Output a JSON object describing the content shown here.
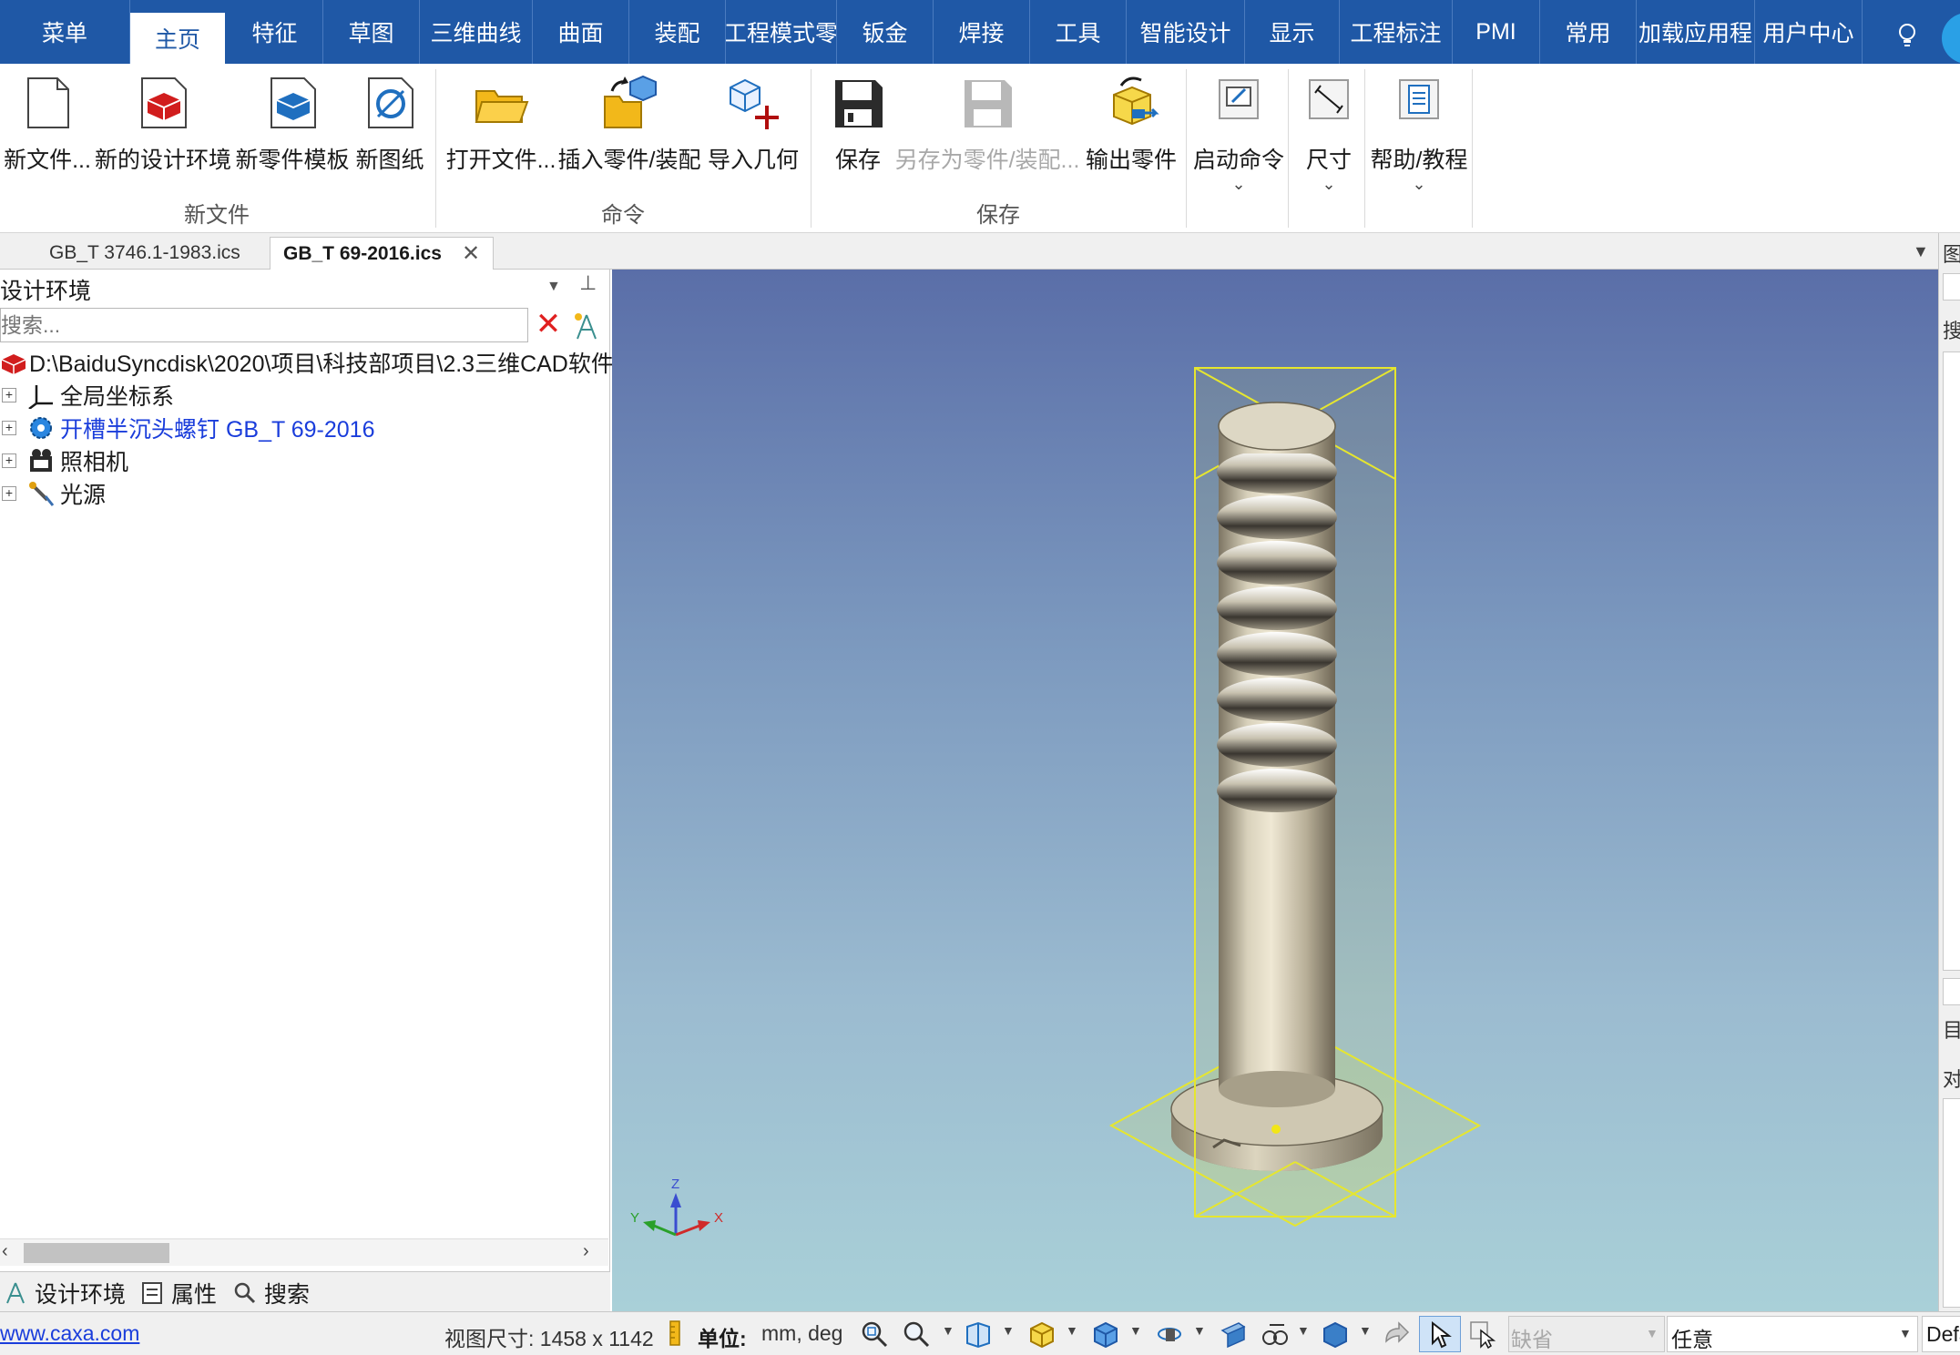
{
  "menubar": {
    "tabs": [
      "菜单",
      "主页",
      "特征",
      "草图",
      "三维曲线",
      "曲面",
      "装配",
      "工程模式零",
      "钣金",
      "焊接",
      "工具",
      "智能设计",
      "显示",
      "工程标注",
      "PMI",
      "常用",
      "加载应用程",
      "用户中心"
    ],
    "active_tab": "主页"
  },
  "ribbon": {
    "buttons": {
      "new_file": "新文件...",
      "new_design_env": "新的设计环境",
      "new_part_template": "新零件模板",
      "new_drawing": "新图纸",
      "open_file": "打开文件...",
      "insert_part": "插入零件/装配",
      "import_geometry": "导入几何",
      "save": "保存",
      "save_as": "另存为零件/装配...",
      "export_part": "输出零件",
      "start_command": "启动命令",
      "dimension": "尺寸",
      "help_tutorial": "帮助/教程"
    },
    "groups": {
      "new_file": "新文件",
      "command": "命令",
      "save": "保存"
    }
  },
  "doctabs": {
    "tab1": "GB_T 3746.1-1983.ics",
    "tab2": "GB_T 69-2016.ics",
    "close": "✕"
  },
  "panel": {
    "title": "设计环境",
    "search_placeholder": "搜索...",
    "tree": {
      "root": "D:\\BaiduSyncdisk\\2020\\项目\\科技部项目\\2.3三维CAD软件",
      "items": [
        "全局坐标系",
        "开槽半沉头螺钉 GB_T 69-2016",
        "照相机",
        "光源"
      ]
    },
    "bottom_tabs": [
      "设计环境",
      "属性",
      "搜索"
    ]
  },
  "viewport": {
    "axes": {
      "x": "X",
      "y": "Y",
      "z": "Z"
    }
  },
  "right_strip": {
    "t1": "图",
    "t2": "搜",
    "t3": "目",
    "t4": "对"
  },
  "statusbar": {
    "link": "www.caxa.com",
    "view_size": "视图尺寸: 1458 x 1142",
    "unit_label": "单位:",
    "unit_value": "mm, deg",
    "default": "缺省",
    "any": "任意",
    "defa": "Defa"
  },
  "colors": {
    "menubar": "#1f58a6",
    "accent": "#1f58a6",
    "link": "#1a3ddb",
    "viewport_top": "#5a6ea8",
    "viewport_bottom": "#a9d0d8",
    "bounding_box": "#e6e62e"
  }
}
